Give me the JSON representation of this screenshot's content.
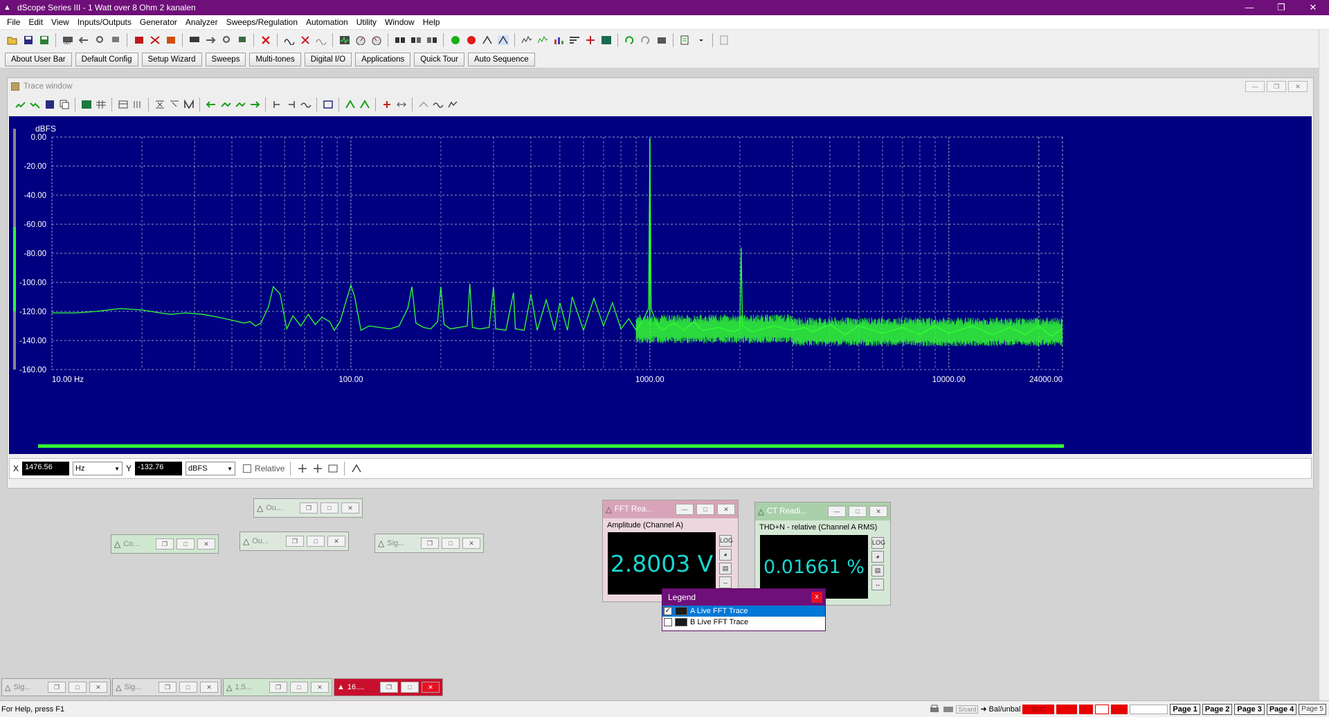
{
  "window": {
    "title": "dScope Series III - 1 Watt over 8 Ohm 2 kanalen"
  },
  "menu": [
    "File",
    "Edit",
    "View",
    "Inputs/Outputs",
    "Generator",
    "Analyzer",
    "Sweeps/Regulation",
    "Automation",
    "Utility",
    "Window",
    "Help"
  ],
  "userbar": [
    "About User Bar",
    "Default Config",
    "Setup Wizard",
    "Sweeps",
    "Multi-tones",
    "Digital I/O",
    "Applications",
    "Quick Tour",
    "Auto Sequence"
  ],
  "trace_window": {
    "title": "Trace window"
  },
  "readout": {
    "x_label": "X",
    "x_value": "1476.56",
    "x_unit": "Hz",
    "y_label": "Y",
    "y_value": "-132.76",
    "y_unit": "dBFS",
    "relative_label": "Relative"
  },
  "mini_windows": {
    "w1": "Ou...",
    "w2": "Co...",
    "w3": "Ou...",
    "w4": "Sig..."
  },
  "fft_reading": {
    "title": "FFT Rea...",
    "subtitle": "Amplitude (Channel A)",
    "value": "2.8003 V"
  },
  "ct_reading": {
    "title": "CT Readi...",
    "subtitle": "THD+N - relative (Channel A RMS)",
    "value": "0.01661 %"
  },
  "legend": {
    "title": "Legend",
    "items": [
      {
        "label": "A Live FFT Trace",
        "checked": true
      },
      {
        "label": "B Live FFT Trace",
        "checked": false
      }
    ]
  },
  "taskbar": {
    "t1": "Sig...",
    "t2": "Sig...",
    "t3": "1.5...",
    "t4": "16...."
  },
  "statusbar": {
    "help": "For Help, press F1",
    "card": "S/card",
    "balance": "Bal/unbal",
    "pages": [
      "Page 1",
      "Page 2",
      "Page 3",
      "Page 4",
      "Page 5"
    ]
  },
  "colors": {
    "titlebar": "#6f0f79",
    "plot_bg": "#000080",
    "trace": "#33ff33",
    "grid": "#a9b2c7",
    "readout_text": "#19d7d0",
    "alert_red": "#e60000"
  },
  "chart_data": {
    "type": "line",
    "xscale": "log",
    "xlim": [
      10,
      24000
    ],
    "ylim": [
      -160,
      0
    ],
    "ylabel": "dBFS",
    "y_ticks": [
      "0.00",
      "-20.00",
      "-40.00",
      "-60.00",
      "-80.00",
      "-100.00",
      "-120.00",
      "-140.00",
      "-160.00"
    ],
    "x_ticks": [
      {
        "v": 10,
        "label": "10.00 Hz"
      },
      {
        "v": 100,
        "label": "100.00"
      },
      {
        "v": 1000,
        "label": "1000.00"
      },
      {
        "v": 10000,
        "label": "10000.00"
      },
      {
        "v": 24000,
        "label": "24000.00"
      }
    ],
    "grid": true,
    "series": [
      {
        "name": "A Live FFT Trace",
        "points": [
          [
            10,
            -121
          ],
          [
            11,
            -121
          ],
          [
            12,
            -121
          ],
          [
            14,
            -120
          ],
          [
            17,
            -118
          ],
          [
            20,
            -119
          ],
          [
            23,
            -121
          ],
          [
            25,
            -122
          ],
          [
            28,
            -121
          ],
          [
            32,
            -122
          ],
          [
            36,
            -124
          ],
          [
            40,
            -126
          ],
          [
            44,
            -128
          ],
          [
            46,
            -127
          ],
          [
            48,
            -130
          ],
          [
            50,
            -128
          ],
          [
            53,
            -117
          ],
          [
            55,
            -103
          ],
          [
            58,
            -108
          ],
          [
            61,
            -132
          ],
          [
            64,
            -123
          ],
          [
            68,
            -130
          ],
          [
            72,
            -122
          ],
          [
            76,
            -129
          ],
          [
            80,
            -124
          ],
          [
            85,
            -127
          ],
          [
            88,
            -133
          ],
          [
            92,
            -127
          ],
          [
            96,
            -114
          ],
          [
            100,
            -102
          ],
          [
            103,
            -110
          ],
          [
            108,
            -133
          ],
          [
            115,
            -130
          ],
          [
            125,
            -131
          ],
          [
            135,
            -132
          ],
          [
            145,
            -130
          ],
          [
            155,
            -118
          ],
          [
            160,
            -103
          ],
          [
            165,
            -128
          ],
          [
            175,
            -131
          ],
          [
            185,
            -132
          ],
          [
            195,
            -127
          ],
          [
            200,
            -103
          ],
          [
            205,
            -129
          ],
          [
            215,
            -132
          ],
          [
            230,
            -131
          ],
          [
            245,
            -130
          ],
          [
            250,
            -101
          ],
          [
            255,
            -131
          ],
          [
            270,
            -132
          ],
          [
            290,
            -131
          ],
          [
            300,
            -103
          ],
          [
            305,
            -132
          ],
          [
            330,
            -133
          ],
          [
            350,
            -107
          ],
          [
            355,
            -132
          ],
          [
            380,
            -133
          ],
          [
            400,
            -108
          ],
          [
            420,
            -133
          ],
          [
            450,
            -112
          ],
          [
            480,
            -133
          ],
          [
            500,
            -114
          ],
          [
            530,
            -133
          ],
          [
            550,
            -110
          ],
          [
            600,
            -133
          ],
          [
            650,
            -111
          ],
          [
            700,
            -130
          ],
          [
            750,
            -114
          ],
          [
            800,
            -132
          ],
          [
            850,
            -125
          ],
          [
            900,
            -133
          ],
          [
            950,
            -126
          ],
          [
            990,
            -118
          ],
          [
            1000,
            -1
          ],
          [
            1010,
            -118
          ],
          [
            1050,
            -128
          ],
          [
            1100,
            -133
          ],
          [
            1200,
            -128
          ],
          [
            1300,
            -133
          ],
          [
            1400,
            -127
          ],
          [
            1500,
            -133
          ],
          [
            1700,
            -131
          ],
          [
            1900,
            -134
          ],
          [
            2000,
            -132
          ],
          [
            2020,
            -76
          ],
          [
            2040,
            -130
          ],
          [
            2200,
            -134
          ],
          [
            2600,
            -130
          ],
          [
            3000,
            -133
          ],
          [
            3300,
            -131
          ],
          [
            3500,
            -134
          ],
          [
            4000,
            -129
          ],
          [
            4500,
            -136
          ],
          [
            5000,
            -130
          ],
          [
            6000,
            -135
          ],
          [
            7000,
            -131
          ],
          [
            8000,
            -136
          ],
          [
            9000,
            -130
          ],
          [
            10000,
            -135
          ],
          [
            12000,
            -130
          ],
          [
            14000,
            -136
          ],
          [
            16000,
            -131
          ],
          [
            18000,
            -136
          ],
          [
            20000,
            -130
          ],
          [
            22000,
            -137
          ],
          [
            24000,
            -132
          ]
        ]
      }
    ],
    "annotations": {
      "fundamental": {
        "x": 1000,
        "y": -1
      }
    }
  }
}
